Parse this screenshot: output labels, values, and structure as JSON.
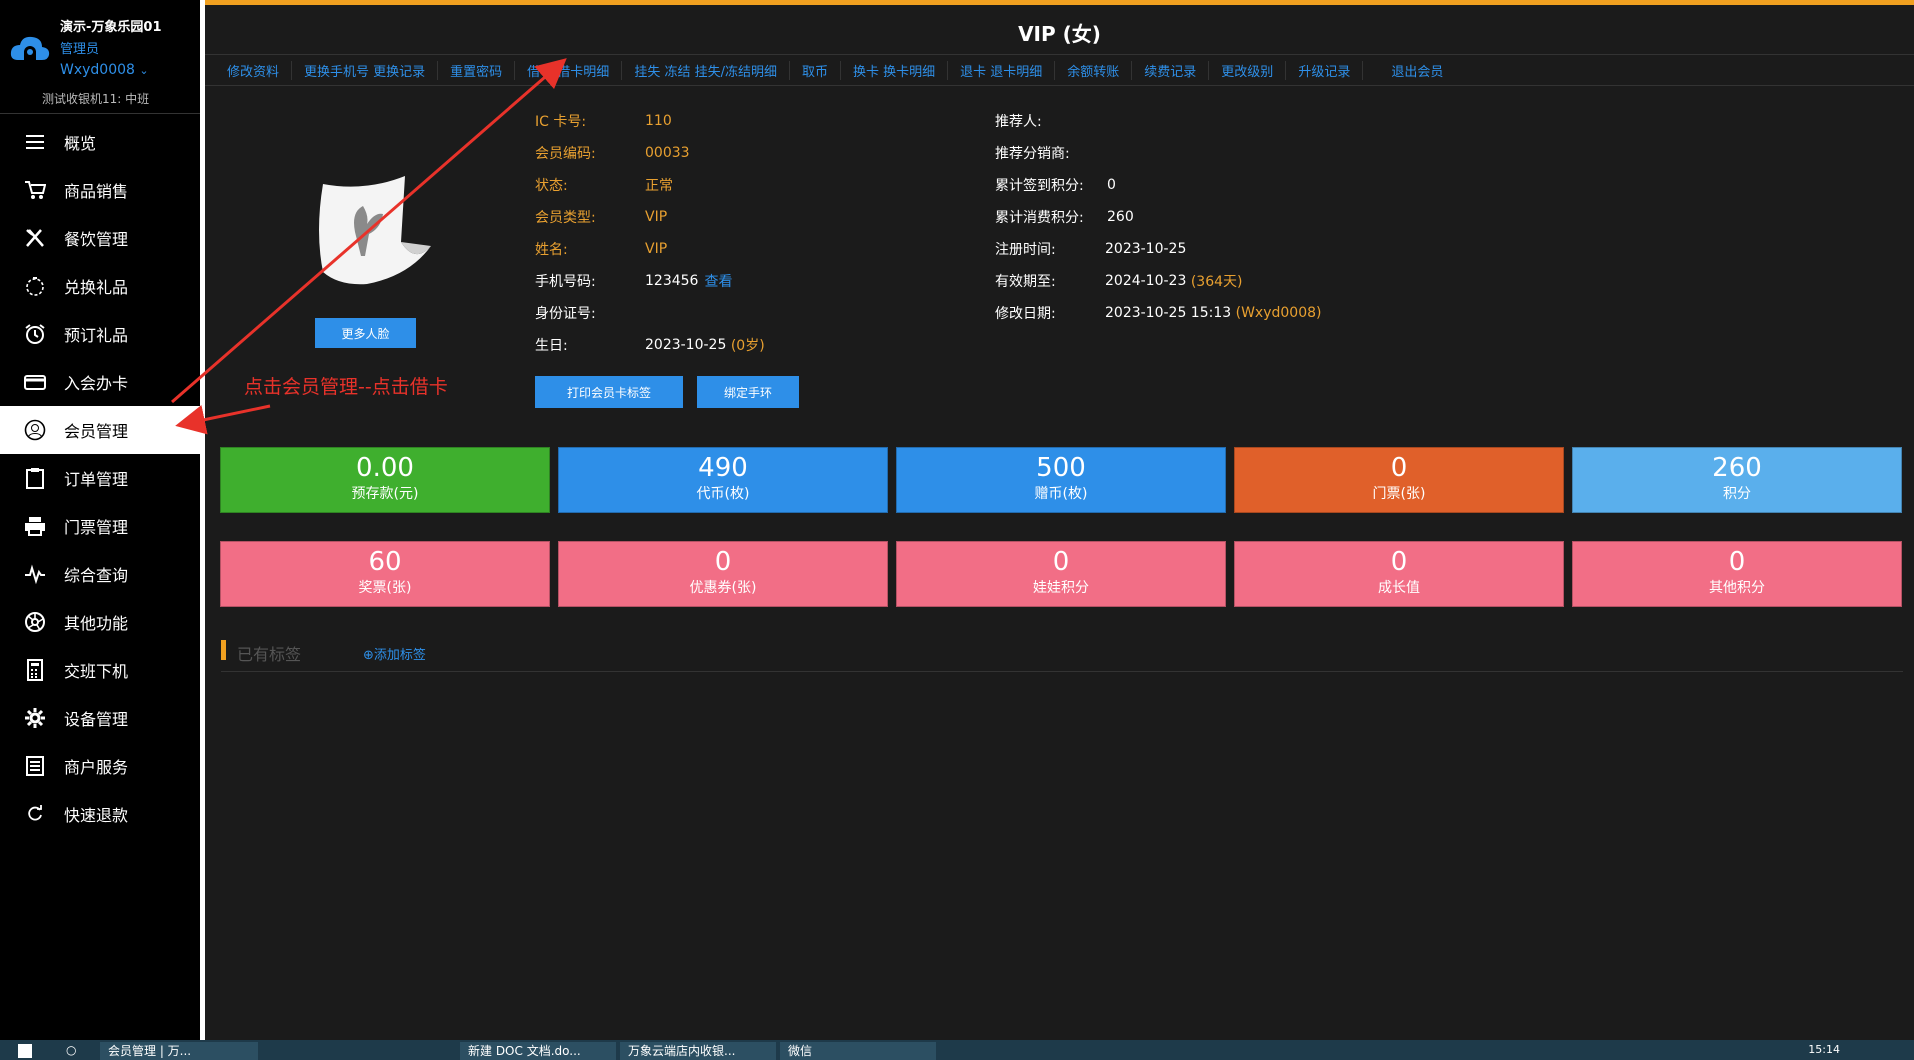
{
  "sidebar": {
    "store_name": "演示-万象乐园01",
    "role": "管理员",
    "user": "Wxyd0008",
    "terminal": "测试收银机11: 中班",
    "items": [
      {
        "label": "概览",
        "icon": "menu-icon"
      },
      {
        "label": "商品销售",
        "icon": "cart-icon"
      },
      {
        "label": "餐饮管理",
        "icon": "utensils-icon"
      },
      {
        "label": "兑换礼品",
        "icon": "gift-icon"
      },
      {
        "label": "预订礼品",
        "icon": "alarm-clock-icon"
      },
      {
        "label": "入会办卡",
        "icon": "card-icon"
      },
      {
        "label": "会员管理",
        "icon": "user-icon"
      },
      {
        "label": "订单管理",
        "icon": "clipboard-icon"
      },
      {
        "label": "门票管理",
        "icon": "printer-icon"
      },
      {
        "label": "综合查询",
        "icon": "pulse-icon"
      },
      {
        "label": "其他功能",
        "icon": "aperture-icon"
      },
      {
        "label": "交班下机",
        "icon": "calculator-icon"
      },
      {
        "label": "设备管理",
        "icon": "gear-icon"
      },
      {
        "label": "商户服务",
        "icon": "document-icon"
      },
      {
        "label": "快速退款",
        "icon": "refresh-icon"
      }
    ],
    "active_index": 6
  },
  "main": {
    "title": "VIP (女)",
    "tabs": [
      "修改资料",
      "更换手机号 更换记录",
      "重置密码",
      "借卡 借卡明细",
      "挂失 冻结 挂失/冻结明细",
      "取币",
      "换卡 换卡明细",
      "退卡 退卡明细",
      "余额转账",
      "续费记录",
      "更改级别",
      "升级记录",
      "退出会员"
    ],
    "more_faces_btn": "更多人脸",
    "info_left": {
      "ic_label": "IC 卡号:",
      "ic_value": "110",
      "code_label": "会员编码:",
      "code_value": "00033",
      "status_label": "状态:",
      "status_value": "正常",
      "type_label": "会员类型:",
      "type_value": "VIP",
      "name_label": "姓名:",
      "name_value": "VIP",
      "phone_label": "手机号码:",
      "phone_value": "123456",
      "phone_view": "查看",
      "id_label": "身份证号:",
      "id_value": "",
      "birth_label": "生日:",
      "birth_value": "2023-10-25",
      "birth_age": "(0岁)"
    },
    "info_right": {
      "referrer_label": "推荐人:",
      "referrer_value": "",
      "distributor_label": "推荐分销商:",
      "distributor_value": "",
      "checkin_label": "累计签到积分:",
      "checkin_value": "0",
      "consume_label": "累计消费积分:",
      "consume_value": "260",
      "reg_label": "注册时间:",
      "reg_value": "2023-10-25",
      "valid_label": "有效期至:",
      "valid_value": "2024-10-23",
      "valid_days": "(364天)",
      "modify_label": "修改日期:",
      "modify_value": "2023-10-25 15:13",
      "modify_by": "(Wxyd0008)"
    },
    "print_btn": "打印会员卡标签",
    "band_btn": "绑定手环",
    "stats_row1": [
      {
        "value": "0.00",
        "label": "预存款(元)",
        "color": "#3faf2e"
      },
      {
        "value": "490",
        "label": "代币(枚)",
        "color": "#2e8fe8"
      },
      {
        "value": "500",
        "label": "赠币(枚)",
        "color": "#2e8fe8"
      },
      {
        "value": "0",
        "label": "门票(张)",
        "color": "#e0602a"
      },
      {
        "value": "260",
        "label": "积分",
        "color": "#5aafec"
      }
    ],
    "stats_row2": [
      {
        "value": "60",
        "label": "奖票(张)",
        "color": "#f26e86"
      },
      {
        "value": "0",
        "label": "优惠券(张)",
        "color": "#f26e86"
      },
      {
        "value": "0",
        "label": "娃娃积分",
        "color": "#f26e86"
      },
      {
        "value": "0",
        "label": "成长值",
        "color": "#f26e86"
      },
      {
        "value": "0",
        "label": "其他积分",
        "color": "#f26e86"
      }
    ],
    "tags_title": "已有标签",
    "add_tag": "添加标签",
    "annotation": "点击会员管理--点击借卡"
  },
  "taskbar": {
    "items": [
      "会员管理 | 万...",
      "新建 DOC 文档.do...",
      "万象云端店内收银...",
      "微信"
    ],
    "clock": "15:14"
  }
}
